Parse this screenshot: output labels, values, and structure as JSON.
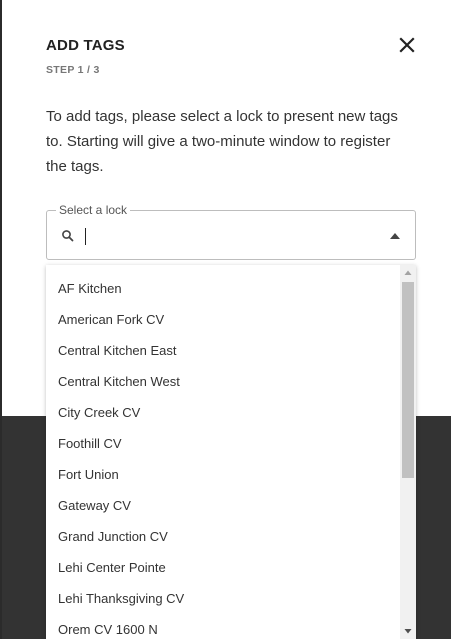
{
  "dialog": {
    "title": "ADD TAGS",
    "step": "STEP 1 / 3",
    "description": "To add tags, please select a lock to present new tags to. Starting will give a two-minute window to register the tags.",
    "close_icon": "close-icon"
  },
  "select": {
    "legend": "Select a lock",
    "value": "",
    "placeholder": "",
    "search_icon": "search-icon",
    "toggle_icon": "caret-up-icon"
  },
  "options": [
    "AF Kitchen",
    "American Fork CV",
    "Central Kitchen East",
    "Central Kitchen West",
    "City Creek CV",
    "Foothill CV",
    "Fort Union",
    "Gateway CV",
    "Grand Junction CV",
    "Lehi Center Pointe",
    "Lehi Thanksgiving CV",
    "Orem CV 1600 N"
  ],
  "colors": {
    "backdrop": "#333333",
    "dialog_bg": "#ffffff",
    "text": "#333333",
    "border": "#bdbdbd",
    "scroll_thumb": "#c1c1c1"
  }
}
